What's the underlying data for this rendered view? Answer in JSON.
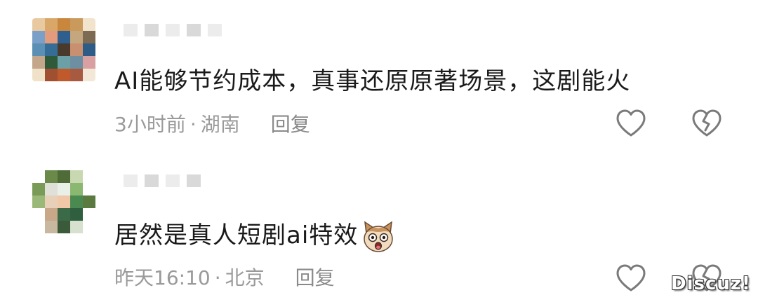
{
  "comments": [
    {
      "text": "AI能够节约成本，真事还原原著场景，这剧能火",
      "time": "3小时前",
      "separator": "·",
      "location": "湖南",
      "reply_label": "回复"
    },
    {
      "text": "居然是真人短剧ai特效",
      "emoji": "surprised-cat-emoji",
      "time": "昨天16:10",
      "separator": "·",
      "location": "北京",
      "reply_label": "回复"
    }
  ],
  "watermark": "Discuz!",
  "colors": {
    "text": "#1a1a1a",
    "meta": "#9a9a9a",
    "icon": "#777777"
  }
}
